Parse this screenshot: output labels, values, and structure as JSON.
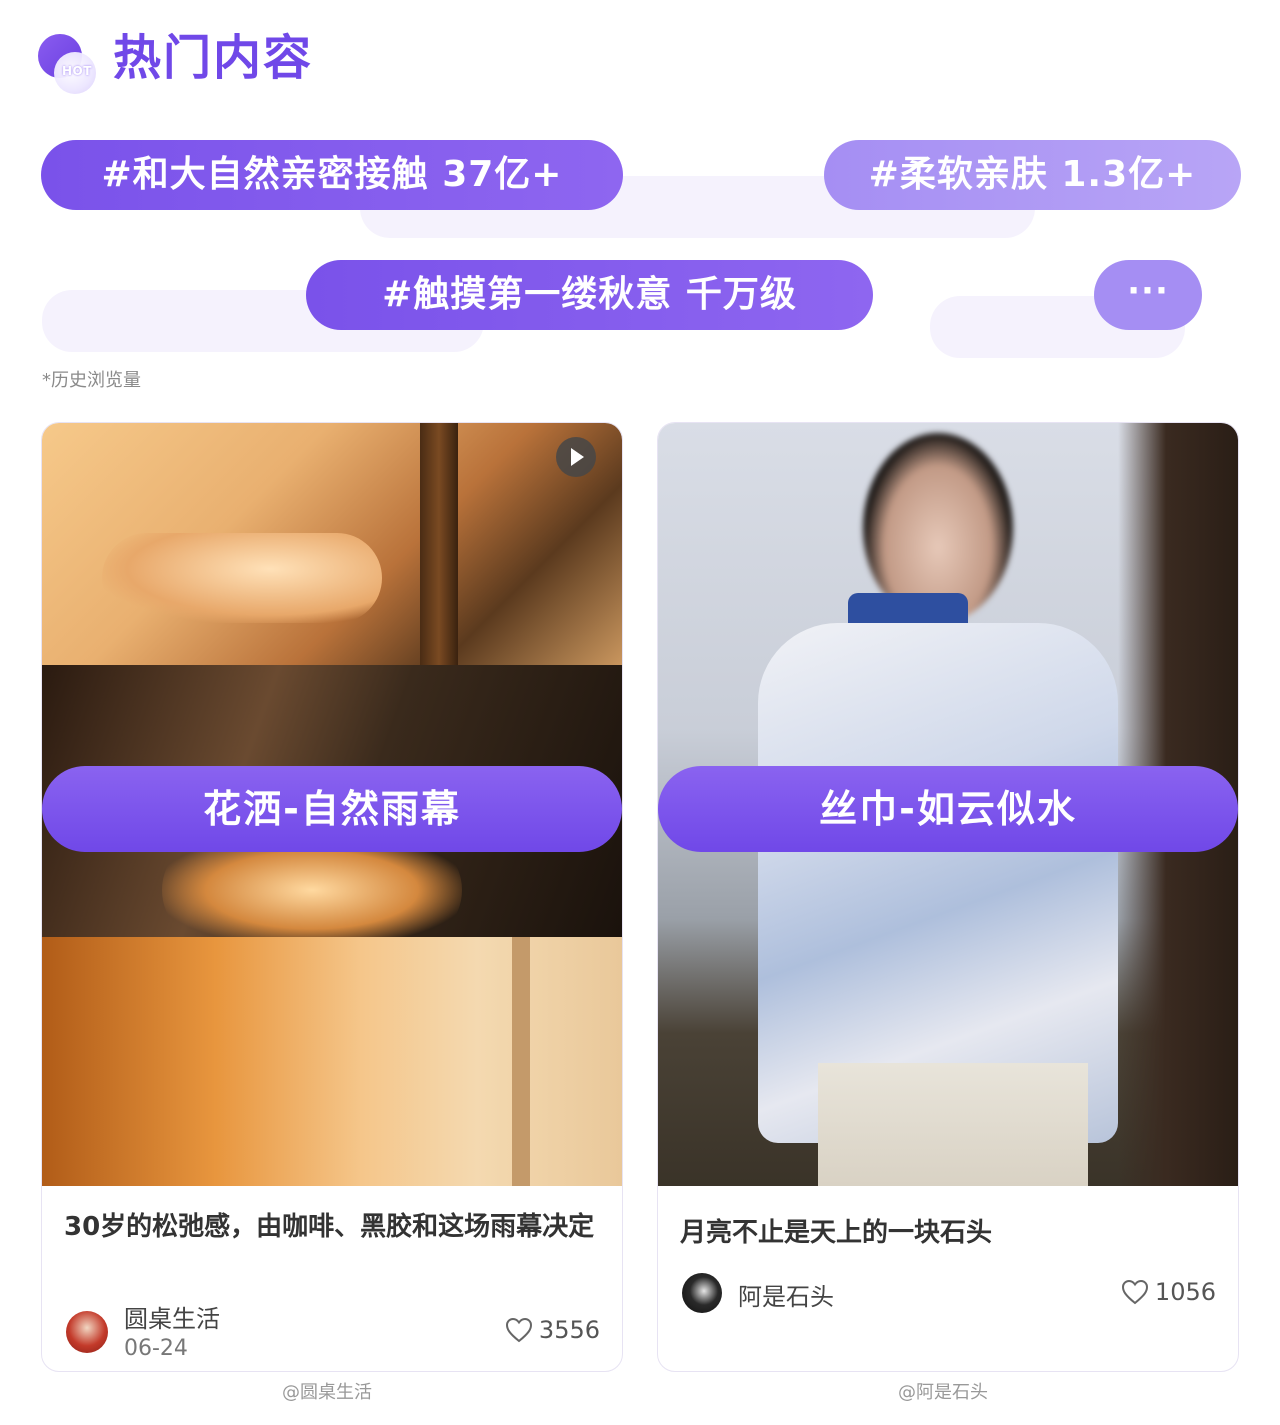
{
  "header": {
    "title": "热门内容",
    "badge": "HOT"
  },
  "tags": [
    {
      "label": "#和大自然亲密接触 37亿+"
    },
    {
      "label": "#柔软亲肤 1.3亿+"
    },
    {
      "label": "#触摸第一缕秋意 千万级"
    },
    {
      "label": "···"
    }
  ],
  "note": "*历史浏览量",
  "cards": [
    {
      "caption": "花洒-自然雨幕",
      "title": "30岁的松弛感，由咖啡、黑胶和这场雨幕决定",
      "author": "圆桌生活",
      "date": "06-24",
      "likes": "3556",
      "credit": "@圆桌生活",
      "has_video": true
    },
    {
      "caption": "丝巾-如云似水",
      "title": "月亮不止是天上的一块石头",
      "author": "阿是石头",
      "likes": "1056",
      "credit": "@阿是石头"
    }
  ],
  "colors": {
    "accent": "#7048e8",
    "tag_dark": "#7a52ea",
    "tag_light": "#a58ef3"
  }
}
